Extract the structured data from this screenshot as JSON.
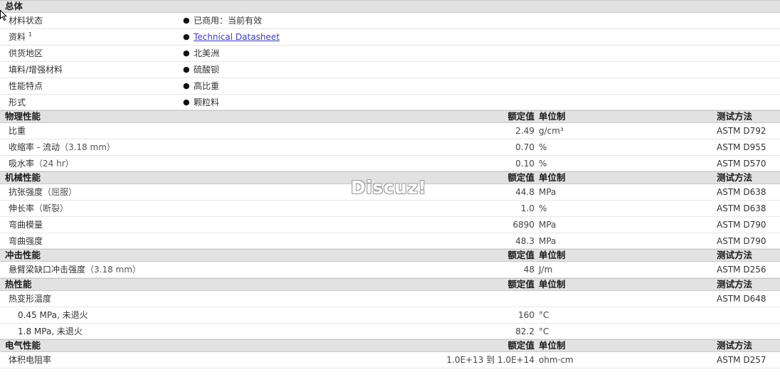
{
  "general": {
    "title": "总体",
    "rows": [
      {
        "label": "材料状态",
        "value": "已商用：当前有效"
      },
      {
        "label": "资料",
        "sup": "1",
        "value": "Technical Datasheet"
      },
      {
        "label": "供货地区",
        "value": "北美洲"
      },
      {
        "label": "填料/增强材料",
        "value": "硫酸钡"
      },
      {
        "label": "性能特点",
        "value": "高比重"
      },
      {
        "label": "形式",
        "value": "颗粒料"
      }
    ]
  },
  "columns": {
    "nominal": "额定值",
    "unit": "单位制",
    "method": "测试方法"
  },
  "physical": {
    "title": "物理性能",
    "rows": [
      {
        "label": "比重",
        "cond": "",
        "value": "2.49",
        "unit": "g/cm³",
        "method": "ASTM D792"
      },
      {
        "label": "收缩率 - 流动",
        "cond": "（3.18 mm）",
        "value": "0.70",
        "unit": "%",
        "method": "ASTM D955"
      },
      {
        "label": "吸水率",
        "cond": "（24 hr）",
        "value": "0.10",
        "unit": "%",
        "method": "ASTM D570"
      }
    ]
  },
  "mechanical": {
    "title": "机械性能",
    "rows": [
      {
        "label": "抗张强度",
        "cond": "（屈服）",
        "value": "44.8",
        "unit": "MPa",
        "method": "ASTM D638"
      },
      {
        "label": "伸长率",
        "cond": "（断裂）",
        "value": "1.0",
        "unit": "%",
        "method": "ASTM D638"
      },
      {
        "label": "弯曲模量",
        "cond": "",
        "value": "6890",
        "unit": "MPa",
        "method": "ASTM D790"
      },
      {
        "label": "弯曲强度",
        "cond": "",
        "value": "48.3",
        "unit": "MPa",
        "method": "ASTM D790"
      }
    ]
  },
  "impact": {
    "title": "冲击性能",
    "rows": [
      {
        "label": "悬臂梁缺口冲击强度",
        "cond": "（3.18 mm）",
        "value": "48",
        "unit": "J/m",
        "method": "ASTM D256"
      }
    ]
  },
  "thermal": {
    "title": "热性能",
    "rows": [
      {
        "label": "热变形温度",
        "value": "",
        "unit": "",
        "method": "ASTM D648"
      },
      {
        "label": "0.45 MPa, 未退火",
        "value": "160",
        "unit": "°C",
        "method": ""
      },
      {
        "label": "1.8 MPa, 未退火",
        "value": "82.2",
        "unit": "°C",
        "method": ""
      }
    ]
  },
  "electrical": {
    "title": "电气性能",
    "rows": [
      {
        "label": "体积电阻率",
        "value": "1.0E+13 到  1.0E+14",
        "unit": "ohm·cm",
        "method": "ASTM D257"
      }
    ]
  },
  "watermark": "Discuz!",
  "bullet": "●"
}
